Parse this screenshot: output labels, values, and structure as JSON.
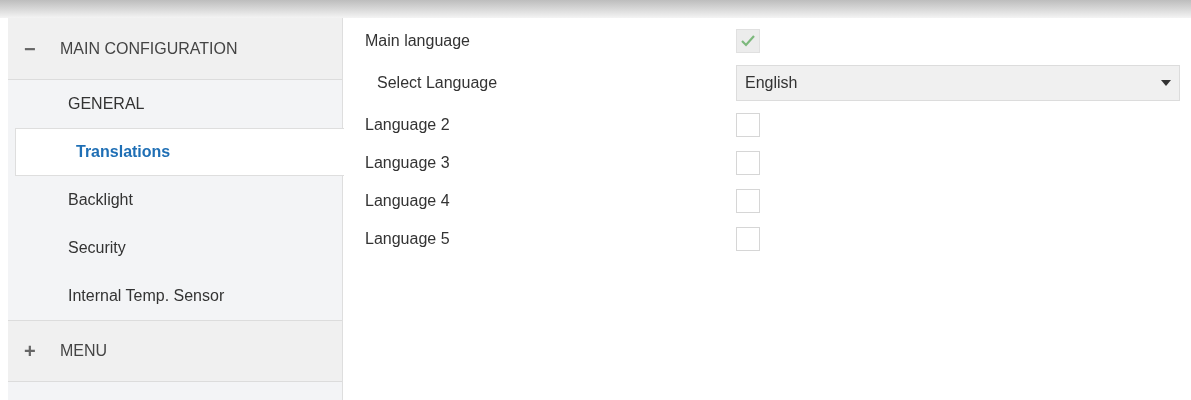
{
  "sidebar": {
    "groups": [
      {
        "sign": "−",
        "title": "MAIN CONFIGURATION",
        "items": [
          {
            "label": "GENERAL",
            "selected": false
          },
          {
            "label": "Translations",
            "selected": true
          },
          {
            "label": "Backlight",
            "selected": false
          },
          {
            "label": "Security",
            "selected": false
          },
          {
            "label": "Internal Temp. Sensor",
            "selected": false
          }
        ]
      },
      {
        "sign": "+",
        "title": "MENU"
      }
    ]
  },
  "parameters": [
    {
      "kind": "checkbox",
      "label": "Main language",
      "checked": true,
      "disabled": true
    },
    {
      "kind": "dropdown",
      "label": "Select Language",
      "value": "English"
    },
    {
      "kind": "checkbox",
      "label": "Language 2",
      "checked": false,
      "disabled": false
    },
    {
      "kind": "checkbox",
      "label": "Language 3",
      "checked": false,
      "disabled": false
    },
    {
      "kind": "checkbox",
      "label": "Language 4",
      "checked": false,
      "disabled": false
    },
    {
      "kind": "checkbox",
      "label": "Language 5",
      "checked": false,
      "disabled": false
    }
  ]
}
